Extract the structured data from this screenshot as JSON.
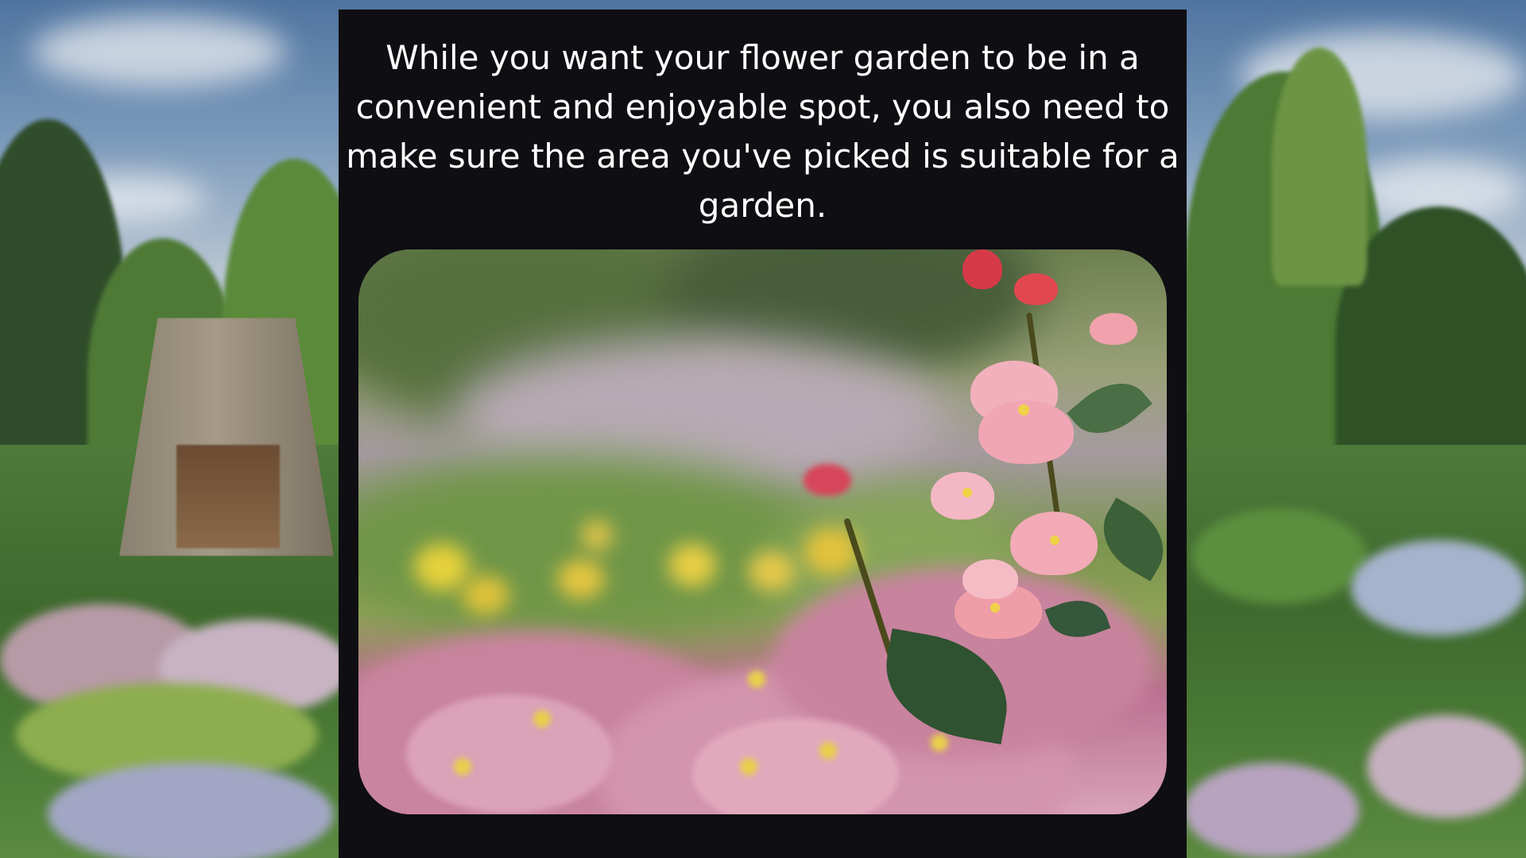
{
  "caption": {
    "text": "While you want your flower garden to be in a convenient and enjoyable spot, you also need to make sure the area you've picked is suitable for a garden."
  },
  "background": {
    "scene": "garden-landscape",
    "colors": {
      "sky": "#5d7fa0",
      "foliage": "#3f6a2e",
      "flowers": "#c9a3c0"
    }
  },
  "card": {
    "background_color": "#0f0e12",
    "text_color": "#ffffff"
  },
  "photo": {
    "subject": "pink-flowers-closeup",
    "colors": {
      "pink": "#e6a2b4",
      "yellow": "#e0c54a",
      "leaf": "#2f5230"
    }
  }
}
